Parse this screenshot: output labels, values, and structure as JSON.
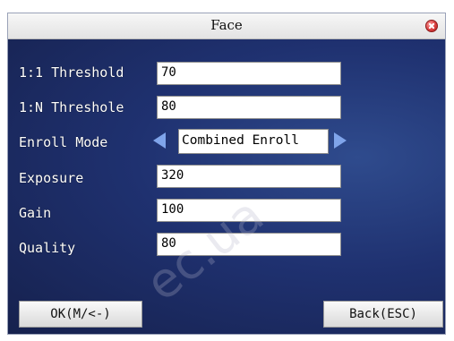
{
  "window": {
    "title": "Face"
  },
  "settings": {
    "threshold_1_1": {
      "label": "1:1 Threshold",
      "value": "70"
    },
    "threshold_1_n": {
      "label": "1:N Threshole",
      "value": "80"
    },
    "enroll_mode": {
      "label": "Enroll Mode",
      "value": "Combined Enroll"
    },
    "exposure": {
      "label": "Exposure",
      "value": "320"
    },
    "gain": {
      "label": "Gain",
      "value": "100"
    },
    "quality": {
      "label": "Quality",
      "value": "80"
    }
  },
  "buttons": {
    "ok": "OK(M/<-)",
    "back": "Back(ESC)"
  },
  "watermark": "ec.ua",
  "icons": {
    "close": "close-icon",
    "left": "arrow-left-icon",
    "right": "arrow-right-icon"
  }
}
